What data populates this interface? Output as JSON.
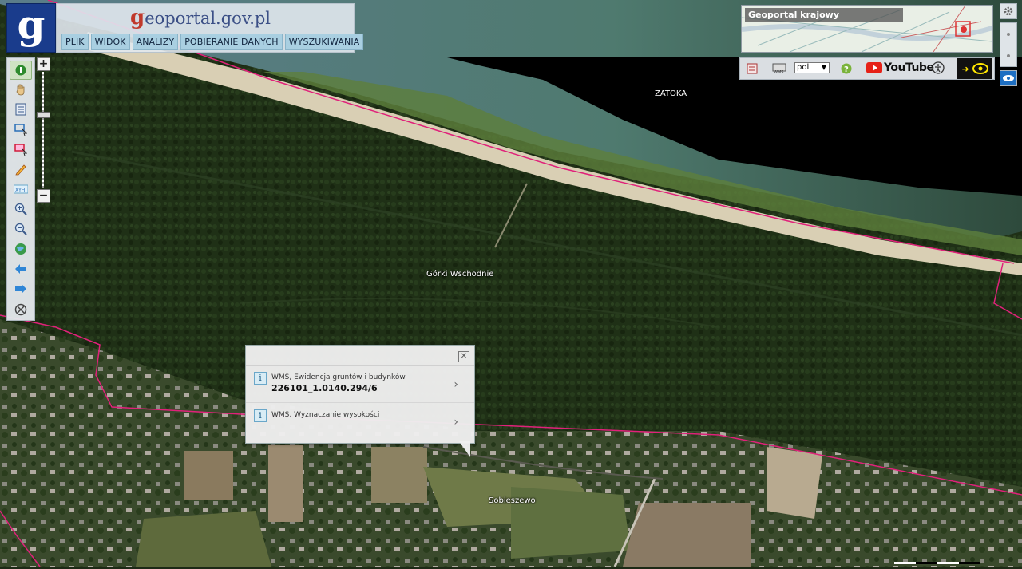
{
  "header": {
    "logo_letter": "g",
    "site_title_rest": "eoportal.gov.pl",
    "site_title_first": "g",
    "menu": [
      "PLIK",
      "WIDOK",
      "ANALIZY",
      "POBIERANIE DANYCH",
      "WYSZUKIWANIA"
    ]
  },
  "overview": {
    "title": "Geoportal krajowy"
  },
  "tools": {
    "language": "pol",
    "youtube": "YouTube"
  },
  "map": {
    "labels": {
      "sea": "ZATOKA",
      "forest": "Górki Wschodnie",
      "village": "Sobieszewo"
    }
  },
  "popup": {
    "items": [
      {
        "label": "WMS, Ewidencja gruntów i budynków",
        "value": "226101_1.0140.294/6"
      },
      {
        "label": "WMS, Wyznaczanie wysokości",
        "value": ""
      }
    ]
  },
  "colors": {
    "boundary": "#e0217a",
    "header_bg": "#1a3c8c",
    "menu_bg": "#a9cfe1"
  }
}
